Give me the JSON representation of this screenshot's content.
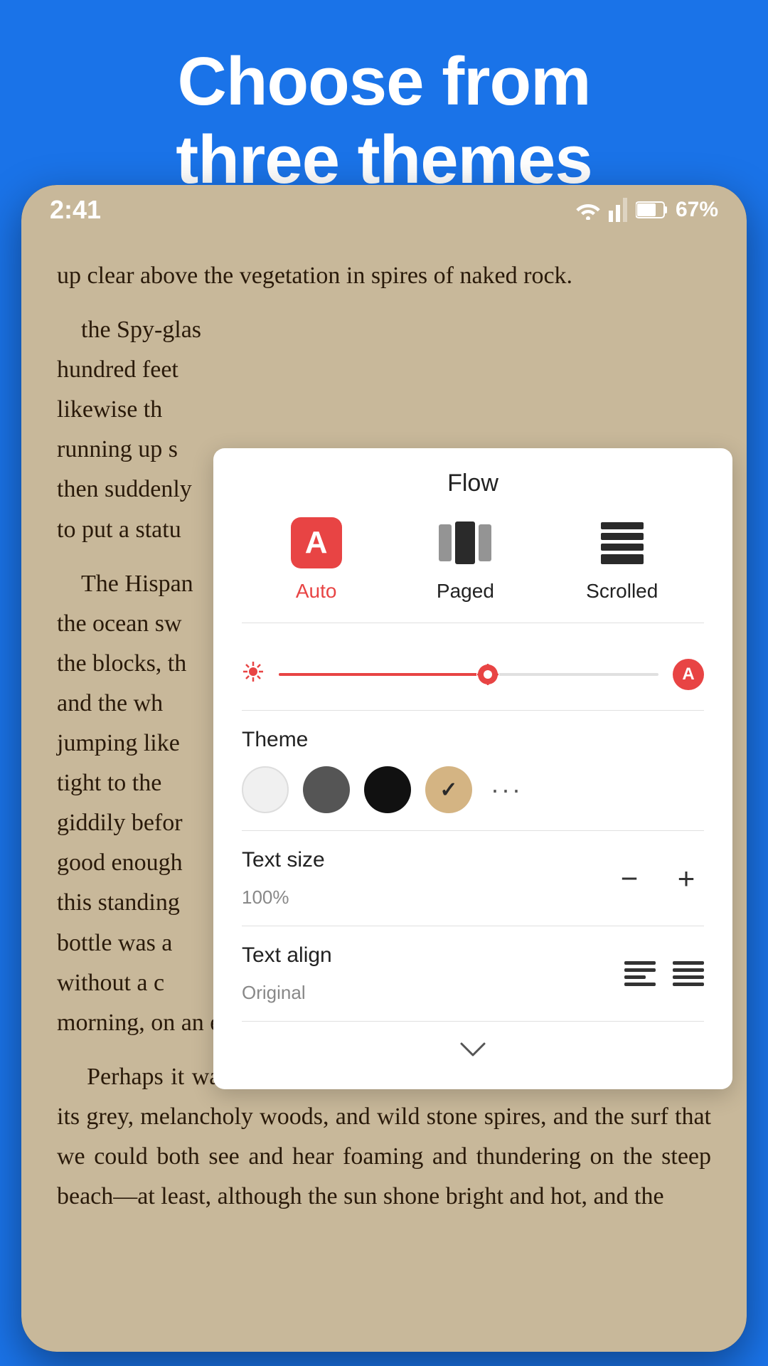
{
  "header": {
    "title": "Choose from\nthree themes",
    "background_color": "#1a73e8"
  },
  "status_bar": {
    "time": "2:41",
    "battery": "67%"
  },
  "book_text": {
    "paragraph1": "up clear above the vegetation in spires of naked rock.",
    "paragraph2": "the Spy-glas hundred feet likewise th running up s then suddenly to put a statu",
    "paragraph3": "The Hispan the ocean sw the blocks, th and the wh jumping like tight to the giddily befor good enough this standing bottle was a without a c morning, on an empty stomach.",
    "paragraph4": "Perhaps it was this—perhaps it was the look of the island, with its grey, melancholy woods, and wild stone spires, and the surf that we could both see and hear foaming and thundering on the steep beach—at least, although the sun shone bright and hot, and the"
  },
  "flow_panel": {
    "title": "Flow",
    "options": [
      {
        "id": "auto",
        "label": "Auto",
        "active": true
      },
      {
        "id": "paged",
        "label": "Paged",
        "active": false
      },
      {
        "id": "scrolled",
        "label": "Scrolled",
        "active": false
      }
    ],
    "theme": {
      "label": "Theme",
      "options": [
        {
          "id": "white",
          "label": "White"
        },
        {
          "id": "gray",
          "label": "Gray"
        },
        {
          "id": "black",
          "label": "Black"
        },
        {
          "id": "sepia",
          "label": "Sepia",
          "selected": true
        }
      ],
      "more_label": "···"
    },
    "text_size": {
      "label": "Text size",
      "value": "100%",
      "minus_label": "−",
      "plus_label": "+"
    },
    "text_align": {
      "label": "Text align",
      "subtitle": "Original"
    },
    "chevron_label": "⌄"
  }
}
